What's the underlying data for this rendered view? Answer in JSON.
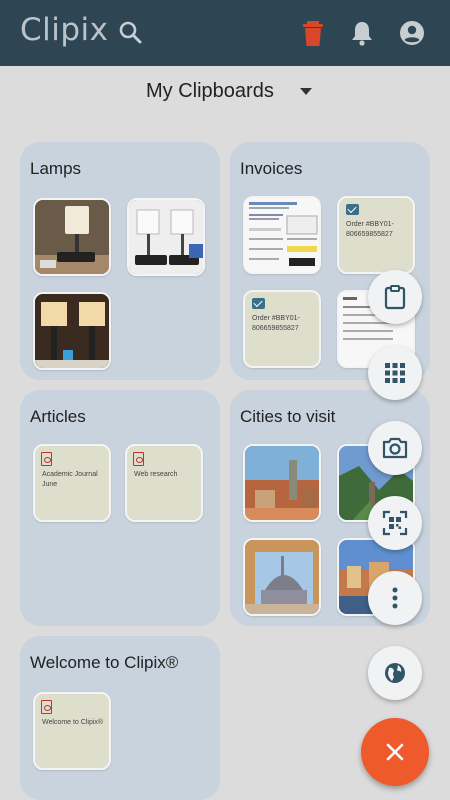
{
  "app": {
    "logo": "Clipix"
  },
  "colors": {
    "appbar": "#2e4553",
    "accent": "#ee5a2b",
    "delete": "#d8472a",
    "fab_icon": "#2f5567",
    "card": "#c8d3de"
  },
  "header": {
    "icons": [
      "search-icon",
      "trash-icon",
      "bell-icon",
      "account-icon"
    ],
    "selector_label": "My Clipboards"
  },
  "boards": [
    {
      "title": "Lamps"
    },
    {
      "title": "Invoices",
      "items": [
        "Order #BBY01-806659855827",
        "Order #BBY01-806659855827"
      ]
    },
    {
      "title": "Articles",
      "items": [
        "Academic Journal June",
        "Web research"
      ]
    },
    {
      "title": "Cities to visit"
    },
    {
      "title": "Welcome to Clipix®",
      "items": [
        "Welcome to Clipix®"
      ]
    }
  ],
  "fab_menu": [
    "clipboard-icon",
    "grid-icon",
    "camera-icon",
    "qr-scan-icon",
    "more-vertical-icon",
    "globe-icon",
    "close-icon"
  ]
}
